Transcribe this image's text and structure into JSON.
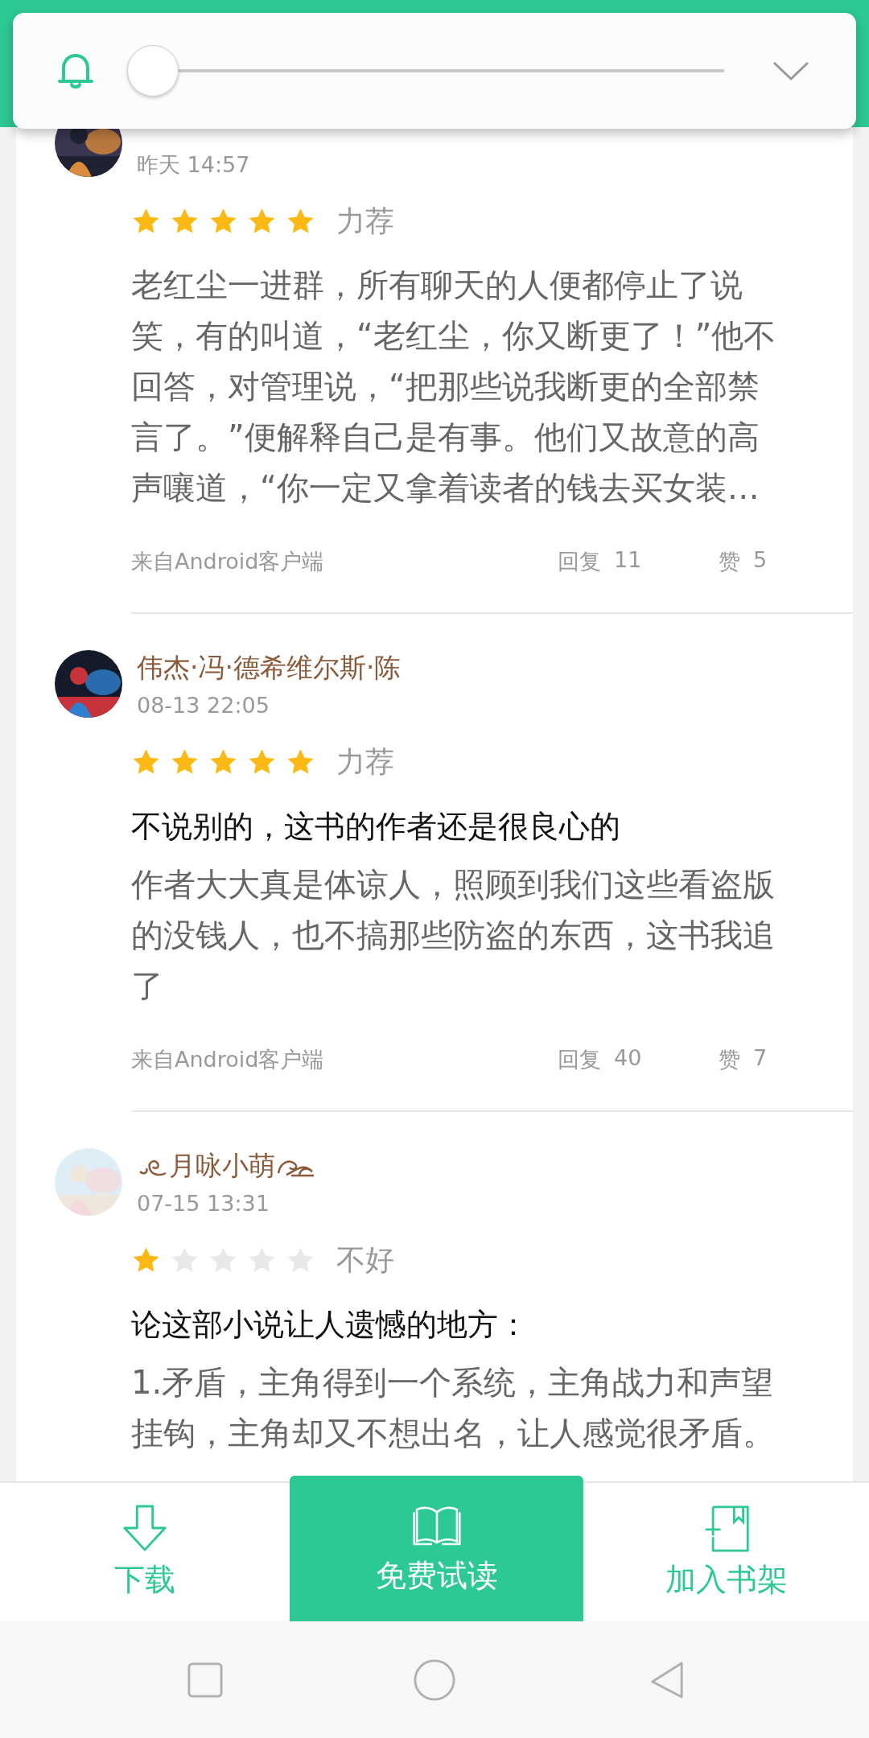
{
  "volume_panel": {
    "level": 0
  },
  "reviews": [
    {
      "time": "昨天 14:57",
      "stars": 5,
      "rating": "力荐",
      "body": "老红尘一进群，所有聊天的人便都停止了说笑，有的叫道，“老红尘，你又断更了！”他不回答，对管理说，“把那些说我断更的全部禁言了。”便解释自己是有事。他们又故意的高声嚷道，“你一定又拿着读者的钱去买女装…",
      "source": "来自Android客户端",
      "replies_label": "回复",
      "replies": "11",
      "likes_label": "赞",
      "likes": "5"
    },
    {
      "name": "伟杰·冯·德希维尔斯·陈",
      "time": "08-13 22:05",
      "stars": 5,
      "rating": "力荐",
      "title": "不说别的，这书的作者还是很良心的",
      "body": "作者大大真是体谅人，照顾到我们这些看盗版的没钱人，也不搞那些防盗的东西，这书我追了",
      "source": "来自Android客户端",
      "replies_label": "回复",
      "replies": "40",
      "likes_label": "赞",
      "likes": "7"
    },
    {
      "name": "月咏小萌",
      "name_ornament": true,
      "time": "07-15 13:31",
      "stars": 1,
      "rating": "不好",
      "title": "论这部小说让人遗憾的地方：",
      "body": "1.矛盾，主角得到一个系统，主角战力和声望挂钩，主角却又不想出名，让人感觉很矛盾。"
    }
  ],
  "bottom_bar": [
    {
      "kind": "download",
      "label": "下载"
    },
    {
      "kind": "read",
      "label": "免费试读"
    },
    {
      "kind": "shelf",
      "label": "加入书架"
    }
  ]
}
